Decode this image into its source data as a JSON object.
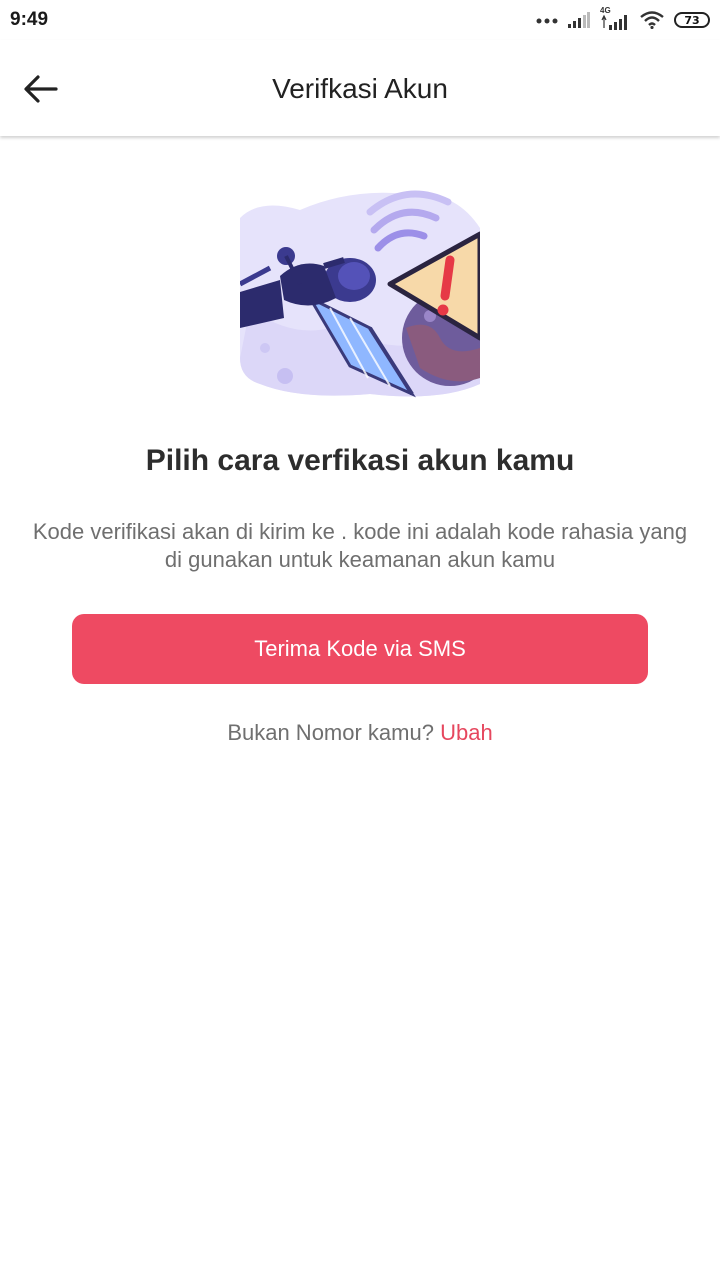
{
  "status_bar": {
    "time": "9:49",
    "network_label": "4G",
    "battery_level": "73",
    "icons": [
      "dots-icon",
      "signal-icon",
      "4g-signal-icon",
      "wifi-icon",
      "battery-icon"
    ]
  },
  "header": {
    "title": "Verifkasi Akun",
    "back_icon": "arrow-left-icon"
  },
  "main": {
    "illustration": "satellite-warning-illustration",
    "heading": "Pilih cara verfikasi akun kamu",
    "description": "Kode verifikasi akan di kirim ke . kode ini adalah kode rahasia yang di gunakan untuk keamanan akun kamu",
    "sms_button_label": "Terima Kode via SMS",
    "not_your_number": "Bukan Nomor kamu?",
    "change_link": "Ubah"
  },
  "colors": {
    "accent": "#ee4a62",
    "link": "#e6475e",
    "text_muted": "#6f6f6f",
    "illustration_bg": "#e6e3fb"
  }
}
